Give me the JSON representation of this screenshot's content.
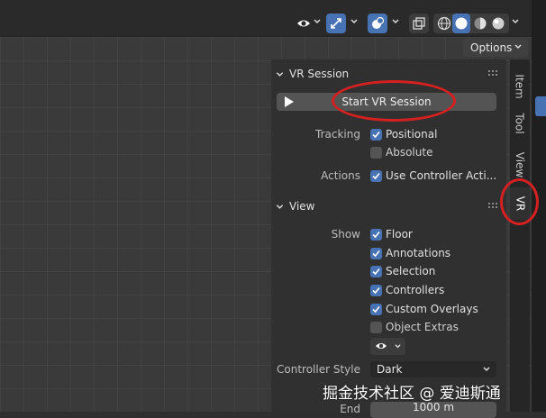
{
  "header": {
    "options_label": "Options"
  },
  "vr_session": {
    "title": "VR Session",
    "start_button": "Start VR Session",
    "tracking_label": "Tracking",
    "positional": {
      "label": "Positional",
      "checked": true
    },
    "absolute": {
      "label": "Absolute",
      "checked": false
    },
    "actions_label": "Actions",
    "use_controller_actions": {
      "label": "Use Controller Acti...",
      "checked": true
    }
  },
  "view": {
    "title": "View",
    "show_label": "Show",
    "items": [
      {
        "label": "Floor",
        "checked": true
      },
      {
        "label": "Annotations",
        "checked": true
      },
      {
        "label": "Selection",
        "checked": true
      },
      {
        "label": "Controllers",
        "checked": true
      },
      {
        "label": "Custom Overlays",
        "checked": true
      },
      {
        "label": "Object Extras",
        "checked": false
      }
    ],
    "controller_style_label": "Controller Style",
    "controller_style_value": "Dark",
    "end_label": "End",
    "end_value": "1000 m"
  },
  "sidebar_tabs": [
    "Item",
    "Tool",
    "View",
    "VR"
  ],
  "active_tab": "VR",
  "watermark": "掘金技术社区 @ 爱迪斯通",
  "colors": {
    "accent": "#4772b3",
    "highlight_ring": "#d42020",
    "panel_bg": "#303030"
  },
  "icons": [
    "visibility-eye-icon",
    "gizmo-icon",
    "overlay-icon",
    "xray-icon",
    "wireframe-shading-icon",
    "solid-shading-icon",
    "material-shading-icon",
    "rendered-shading-icon",
    "play-icon",
    "chevron-down-icon",
    "checkmark-icon",
    "grip-icon"
  ]
}
